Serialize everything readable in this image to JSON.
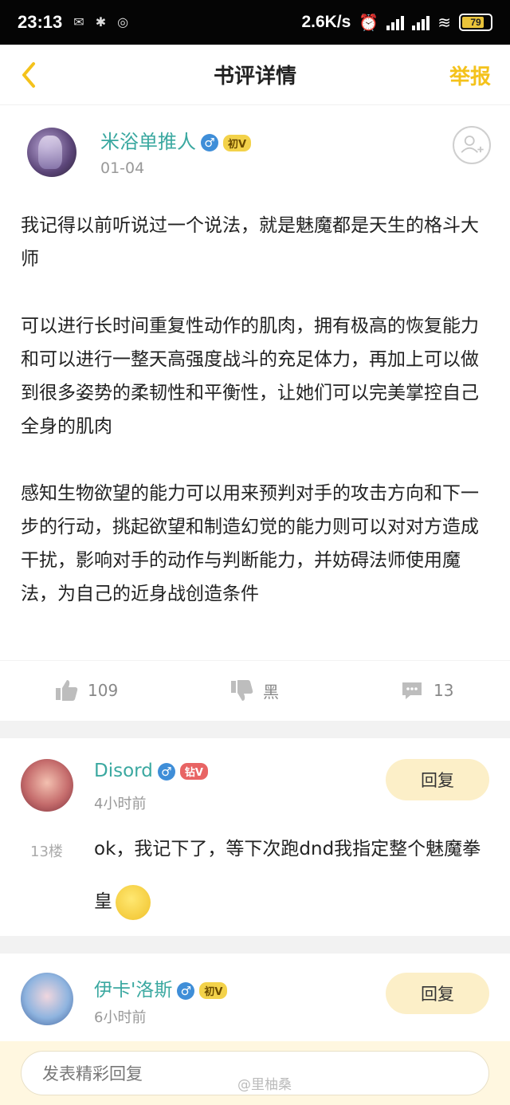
{
  "status_bar": {
    "time": "23:13",
    "speed": "2.6K/s",
    "battery": "79"
  },
  "nav": {
    "title": "书评详情",
    "report": "举报"
  },
  "post": {
    "author": "米浴单推人",
    "badge": "初V",
    "date": "01-04",
    "paragraphs": [
      "我记得以前听说过一个说法，就是魅魔都是天生的格斗大师",
      "可以进行长时间重复性动作的肌肉，拥有极高的恢复能力和可以进行一整天高强度战斗的充足体力，再加上可以做到很多姿势的柔韧性和平衡性，让她们可以完美掌控自己全身的肌肉",
      "感知生物欲望的能力可以用来预判对手的攻击方向和下一步的行动，挑起欲望和制造幻觉的能力则可以对对方造成干扰，影响对手的动作与判断能力，并妨碍法师使用魔法，为自己的近身战创造条件"
    ],
    "likes": "109",
    "dislike_label": "黑",
    "comments": "13"
  },
  "comments": [
    {
      "name": "Disord",
      "badge": "钻V",
      "time": "4小时前",
      "floor": "13楼",
      "text": "ok，我记下了，等下次跑dnd我指定整个魅魔拳皇",
      "reply": "回复"
    },
    {
      "name": "伊卡'洛斯",
      "badge": "初V",
      "time": "6小时前",
      "reply": "回复"
    }
  ],
  "input": {
    "placeholder": "发表精彩回复"
  },
  "watermark": "@里柚桑"
}
